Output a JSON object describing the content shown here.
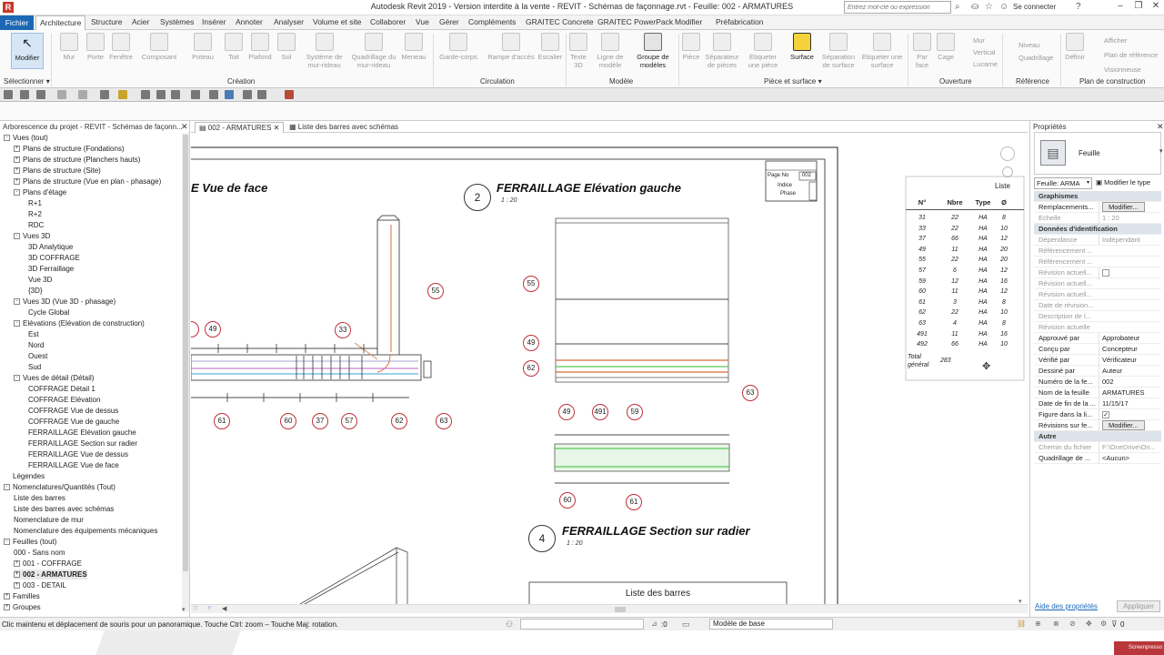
{
  "window": {
    "title": "Autodesk Revit 2019 - Version interdite à la vente - REVIT - Schémas de façonnage.rvt - Feuille: 002 - ARMATURES",
    "search_placeholder": "Entrez mot-clé ou expression",
    "connect_label": "Se connecter",
    "app_logo": "R"
  },
  "ribbon_tabs": [
    "Architecture",
    "Structure",
    "Acier",
    "Systèmes",
    "Insérer",
    "Annoter",
    "Analyser",
    "Volume et site",
    "Collaborer",
    "Vue",
    "Gérer",
    "Compléments",
    "GRAITEC Concrete",
    "GRAITEC PowerPack",
    "Modifier",
    "Préfabrication"
  ],
  "file_tab": "Fichier",
  "ribbon": {
    "tools": {
      "modifier": "Modifier",
      "mur": "Mur",
      "porte": "Porte",
      "fenetre": "Fenêtre",
      "composant": "Composant",
      "poteau": "Poteau",
      "toit": "Toit",
      "plafond": "Plafond",
      "sol": "Sol",
      "systeme_mur_rideau": "Système de mur-rideau",
      "quadrillage_mur_rideau": "Quadrillage du mur-rideau",
      "meneau": "Meneau",
      "garde_corps": "Garde-corps",
      "rampe": "Rampe d'accès",
      "escalier": "Escalier",
      "texte3d": "Texte 3D",
      "ligne_modele": "Ligne de modèle",
      "groupe_modeles": "Groupe de modèles",
      "piece": "Pièce",
      "separateur_pieces": "Séparateur de pièces",
      "etiqueter_piece": "Etiqueter une pièce",
      "surface": "Surface",
      "separation_surface": "Séparation de surface",
      "etiqueter_surface": "Etiqueter une surface",
      "par_face": "Par face",
      "cage": "Cage",
      "mur_small": "Mur",
      "vertical": "Vertical",
      "lucarne": "Lucarne",
      "niveau": "Niveau",
      "quadrillage": "Quadrillage",
      "definir": "Définir",
      "afficher": "Afficher",
      "plan_reference": "Plan de référence",
      "visionneuse": "Visionneuse"
    },
    "panels": {
      "selectionner": "Sélectionner ▾",
      "creation": "Création",
      "circulation": "Circulation",
      "modele": "Modèle",
      "piece_surface": "Pièce et surface ▾",
      "ouverture": "Ouverture",
      "reference": "Référence",
      "plan_construction": "Plan de construction"
    }
  },
  "project_browser": {
    "title": "Arborescence du projet - REVIT - Schémas de façonn...",
    "items": [
      {
        "label": "Vues (tout)",
        "lvl": 0,
        "tg": "-"
      },
      {
        "label": "Plans de structure (Fondations)",
        "lvl": 1,
        "tg": "+"
      },
      {
        "label": "Plans de structure (Planchers hauts)",
        "lvl": 1,
        "tg": "+"
      },
      {
        "label": "Plans de structure (Site)",
        "lvl": 1,
        "tg": "+"
      },
      {
        "label": "Plans de structure (Vue en plan - phasage)",
        "lvl": 1,
        "tg": "+"
      },
      {
        "label": "Plans d'étage",
        "lvl": 1,
        "tg": "-"
      },
      {
        "label": "R+1",
        "lvl": 2,
        "tg": ""
      },
      {
        "label": "R+2",
        "lvl": 2,
        "tg": ""
      },
      {
        "label": "RDC",
        "lvl": 2,
        "tg": ""
      },
      {
        "label": "Vues 3D",
        "lvl": 1,
        "tg": "-"
      },
      {
        "label": "3D Analytique",
        "lvl": 2,
        "tg": ""
      },
      {
        "label": "3D COFFRAGE",
        "lvl": 2,
        "tg": ""
      },
      {
        "label": "3D Ferraillage",
        "lvl": 2,
        "tg": ""
      },
      {
        "label": "Vue 3D",
        "lvl": 2,
        "tg": ""
      },
      {
        "label": "{3D}",
        "lvl": 2,
        "tg": ""
      },
      {
        "label": "Vues 3D (Vue 3D - phasage)",
        "lvl": 1,
        "tg": "-"
      },
      {
        "label": "Cycle Global",
        "lvl": 2,
        "tg": ""
      },
      {
        "label": "Elévations (Elévation de construction)",
        "lvl": 1,
        "tg": "-"
      },
      {
        "label": "Est",
        "lvl": 2,
        "tg": ""
      },
      {
        "label": "Nord",
        "lvl": 2,
        "tg": ""
      },
      {
        "label": "Ouest",
        "lvl": 2,
        "tg": ""
      },
      {
        "label": "Sud",
        "lvl": 2,
        "tg": ""
      },
      {
        "label": "Vues de détail (Détail)",
        "lvl": 1,
        "tg": "-"
      },
      {
        "label": "COFFRAGE Détail 1",
        "lvl": 2,
        "tg": ""
      },
      {
        "label": "COFFRAGE Elévation",
        "lvl": 2,
        "tg": ""
      },
      {
        "label": "COFFRAGE Vue de dessus",
        "lvl": 2,
        "tg": ""
      },
      {
        "label": "COFFRAGE Vue de gauche",
        "lvl": 2,
        "tg": ""
      },
      {
        "label": "FERRAILLAGE Elévation gauche",
        "lvl": 2,
        "tg": ""
      },
      {
        "label": "FERRAILLAGE Section sur radier",
        "lvl": 2,
        "tg": ""
      },
      {
        "label": "FERRAILLAGE Vue de dessus",
        "lvl": 2,
        "tg": ""
      },
      {
        "label": "FERRAILLAGE Vue de face",
        "lvl": 2,
        "tg": ""
      },
      {
        "label": "Légendes",
        "lvl": 0,
        "tg": ""
      },
      {
        "label": "Nomenclatures/Quantités (Tout)",
        "lvl": 0,
        "tg": "-"
      },
      {
        "label": "Liste des barres",
        "lvl": 1,
        "tg": ""
      },
      {
        "label": "Liste des barres avec schémas",
        "lvl": 1,
        "tg": ""
      },
      {
        "label": "Nomenclature de mur",
        "lvl": 1,
        "tg": ""
      },
      {
        "label": "Nomenclature des équipements mécaniques",
        "lvl": 1,
        "tg": ""
      },
      {
        "label": "Feuilles (tout)",
        "lvl": 0,
        "tg": "-"
      },
      {
        "label": "000 - Sans nom",
        "lvl": 1,
        "tg": ""
      },
      {
        "label": "001 - COFFRAGE",
        "lvl": 1,
        "tg": "+"
      },
      {
        "label": "002 - ARMATURES",
        "lvl": 1,
        "tg": "+",
        "sel": true
      },
      {
        "label": "003 - DETAIL",
        "lvl": 1,
        "tg": "+"
      },
      {
        "label": "Familles",
        "lvl": 0,
        "tg": "+"
      },
      {
        "label": "Groupes",
        "lvl": 0,
        "tg": "+"
      }
    ]
  },
  "doc_tabs": [
    "002 - ARMATURES",
    "Liste des barres avec schémas"
  ],
  "sheet": {
    "view1_title": "E Vue de face",
    "view2_num": "2",
    "view2_title": "FERRAILLAGE Elévation gauche",
    "view2_scale": "1 : 20",
    "view4_num": "4",
    "view4_title": "FERRAILLAGE Section sur radier",
    "view4_scale": "1 : 20",
    "titleblock": {
      "page_no_label": "Page No",
      "page_no": "002",
      "indice": "Indice",
      "phase": "Phase"
    },
    "bar_list_title": "Liste des barres",
    "liste_label": "Liste",
    "tags_view1": [
      "49",
      "33",
      "55",
      "61",
      "60",
      "37",
      "57",
      "62",
      "63"
    ],
    "tags_view2": [
      "55",
      "49",
      "62",
      "63"
    ],
    "tags_view4": [
      "49",
      "491",
      "59",
      "60",
      "61"
    ],
    "schedule": {
      "headers": [
        "N°",
        "Nbre",
        "Type",
        "Ø"
      ],
      "rows": [
        [
          "31",
          "22",
          "HA",
          "8"
        ],
        [
          "33",
          "22",
          "HA",
          "10"
        ],
        [
          "37",
          "66",
          "HA",
          "12"
        ],
        [
          "49",
          "11",
          "HA",
          "20"
        ],
        [
          "55",
          "22",
          "HA",
          "20"
        ],
        [
          "57",
          "6",
          "HA",
          "12"
        ],
        [
          "59",
          "12",
          "HA",
          "16"
        ],
        [
          "60",
          "11",
          "HA",
          "12"
        ],
        [
          "61",
          "3",
          "HA",
          "8"
        ],
        [
          "62",
          "22",
          "HA",
          "10"
        ],
        [
          "63",
          "4",
          "HA",
          "8"
        ],
        [
          "491",
          "11",
          "HA",
          "16"
        ],
        [
          "492",
          "66",
          "HA",
          "10"
        ]
      ],
      "total_label1": "Total",
      "total_label2": "général",
      "total_value": "283"
    }
  },
  "properties": {
    "title": "Propriétés",
    "type_name": "Feuille",
    "selector": "Feuille: ARMA",
    "modify_type": "Modifier le type",
    "sections": {
      "graphismes": "Graphismes",
      "donnees": "Données d'identification",
      "autre": "Autre"
    },
    "rows_graph": [
      {
        "k": "Remplacements...",
        "v": "Modifier...",
        "btn": true
      },
      {
        "k": "Echelle",
        "v": "1 : 20",
        "grey": true
      }
    ],
    "rows_id": [
      {
        "k": "Dépendance",
        "v": "Indépendant",
        "grey": true
      },
      {
        "k": "Référencement ...",
        "v": "",
        "grey": true
      },
      {
        "k": "Référencement ...",
        "v": "",
        "grey": true
      },
      {
        "k": "Révision actuell...",
        "v": "",
        "grey": true,
        "chk": true
      },
      {
        "k": "Révision actuell...",
        "v": "",
        "grey": true
      },
      {
        "k": "Révision actuell...",
        "v": "",
        "grey": true
      },
      {
        "k": "Date de révision...",
        "v": "",
        "grey": true
      },
      {
        "k": "Description de l...",
        "v": "",
        "grey": true
      },
      {
        "k": "Révision actuelle",
        "v": "",
        "grey": true
      },
      {
        "k": "Approuvé par",
        "v": "Approbateur"
      },
      {
        "k": "Conçu par",
        "v": "Concepteur"
      },
      {
        "k": "Vérifié par",
        "v": "Vérificateur"
      },
      {
        "k": "Dessiné par",
        "v": "Auteur"
      },
      {
        "k": "Numéro de la fe...",
        "v": "002"
      },
      {
        "k": "Nom de la feuille",
        "v": "ARMATURES"
      },
      {
        "k": "Date de fin de la ...",
        "v": "11/15/17"
      },
      {
        "k": "Figure dans la li...",
        "v": "",
        "chk": true,
        "checked": true
      },
      {
        "k": "Révisions sur fe...",
        "v": "Modifier...",
        "btn": true
      }
    ],
    "rows_other": [
      {
        "k": "Chemin du fichier",
        "v": "F:\\OneDrive\\On...",
        "grey": true
      },
      {
        "k": "Quadrillage de ...",
        "v": "<Aucun>"
      }
    ],
    "help_link": "Aide des propriétés",
    "apply_label": "Appliquer"
  },
  "status": {
    "hint": "Clic maintenu et déplacement de souris pour un panoramique. Touche Ctrl: zoom – Touche Maj: rotation.",
    "zero": ":0",
    "model": "Modèle de base",
    "filter_count": "0"
  },
  "watermark": "Screenpresso"
}
